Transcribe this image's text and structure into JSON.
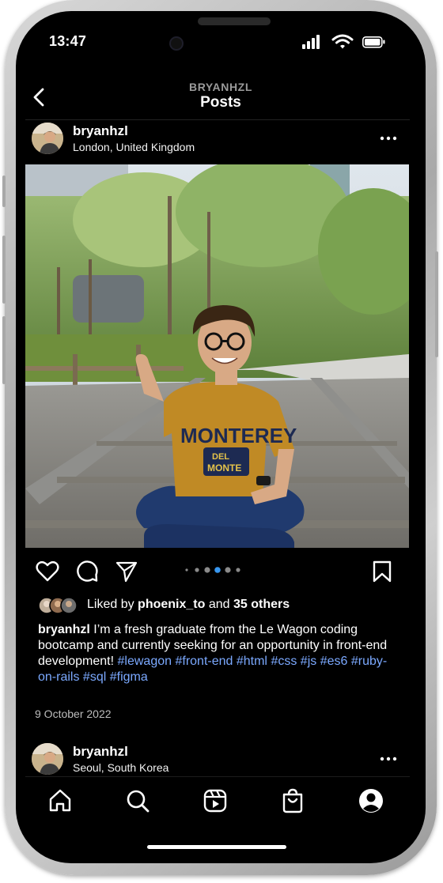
{
  "status": {
    "time": "13:47"
  },
  "header": {
    "username": "BRYANHZL",
    "title": "Posts"
  },
  "post": {
    "username": "bryanhzl",
    "location": "London, United Kingdom",
    "photo_icon": "photo-of-person-on-railway-tracks",
    "shirt_text_main": "MONTEREY",
    "shirt_text_logo_top": "DEL",
    "shirt_text_logo_bottom": "MONTE",
    "carousel": {
      "total": 6,
      "active_index": 3
    },
    "likes": {
      "prefix": "Liked by",
      "user": "phoenix_to",
      "joiner": "and",
      "others": "35 others"
    },
    "caption": {
      "username": "bryanhzl",
      "text": "I’m a fresh graduate from the Le Wagon coding bootcamp and currently seeking for an opportunity in front-end development!",
      "hashtags": [
        "#lewagon",
        "#front-end",
        "#html",
        "#css",
        "#js",
        "#es6",
        "#ruby-on-rails",
        "#sql",
        "#figma"
      ]
    },
    "date": "9 October 2022"
  },
  "next_post": {
    "username": "bryanhzl",
    "location": "Seoul, South Korea"
  },
  "icons": {
    "back": "chevron-left-icon",
    "more": "more-horizontal-icon",
    "like": "heart-icon",
    "comment": "comment-icon",
    "share": "send-icon",
    "save": "bookmark-icon",
    "home": "home-icon",
    "search": "search-icon",
    "reels": "reels-icon",
    "shop": "shop-bag-icon",
    "profile": "profile-icon"
  },
  "colors": {
    "background": "#000000",
    "text": "#ffffff",
    "hashtag": "#7ba9ff",
    "carousel_active": "#3897f0",
    "muted": "#9a9a9a"
  }
}
